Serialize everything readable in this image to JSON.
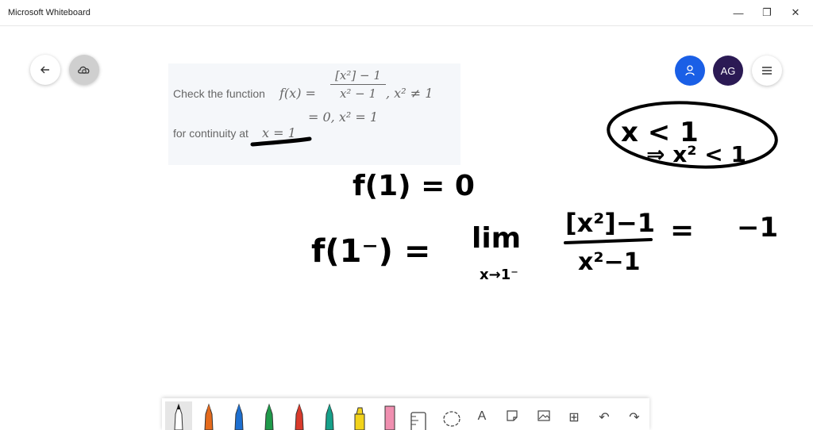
{
  "window": {
    "title": "Microsoft Whiteboard",
    "minimize_glyph": "—",
    "maximize_glyph": "❐",
    "close_glyph": "✕"
  },
  "header": {
    "back_icon": "arrow-left-icon",
    "sync_icon": "cloud-sync-icon",
    "invite_icon": "person-icon",
    "avatar_initials": "AG",
    "menu_icon": "hamburger-icon",
    "invite_color": "#1a5fe6",
    "avatar_color": "#2b1a54"
  },
  "question": {
    "line1_text": "Check the function",
    "fx": "f(x) =",
    "numerator": "[x²] − 1",
    "denominator": "x² − 1",
    "condition1": ",    x² ≠ 1",
    "line2_math": "= 0,    x² = 1",
    "line3_text": "for continuity at",
    "point": "x = 1"
  },
  "ink": {
    "line1": "f(1) = 0",
    "line2_left": "f(1⁻) =",
    "lim": "lim",
    "lim_sub": "x→1⁻",
    "numerator": "[x²]−1",
    "denominator": "x²−1",
    "equals": "=",
    "result": "−1",
    "note_top": "x < 1",
    "note_bottom": "⇒ x² < 1",
    "ink_color": "#000000"
  },
  "toolbar": {
    "tools": [
      {
        "name": "pen-black-icon",
        "color": "#111111"
      },
      {
        "name": "pen-orange-icon",
        "color": "#e46a1c"
      },
      {
        "name": "pen-blue-icon",
        "color": "#1d6fd0"
      },
      {
        "name": "pen-green-icon",
        "color": "#1f9a4a"
      },
      {
        "name": "pen-red-icon",
        "color": "#d93a2b"
      },
      {
        "name": "pen-teal-icon",
        "color": "#16a08a"
      },
      {
        "name": "highlighter-yellow-icon",
        "color": "#f2d31b"
      },
      {
        "name": "eraser-icon",
        "color": "#f08fb0"
      }
    ],
    "ruler_icon": "ruler-icon",
    "lasso_icon": "lasso-icon",
    "text_glyph": "A",
    "text_icon": "text-icon",
    "note_icon": "sticky-note-icon",
    "image_icon": "image-icon",
    "insert_glyph": "⊞",
    "insert_icon": "insert-icon",
    "undo_glyph": "↶",
    "undo_icon": "undo-icon",
    "redo_glyph": "↷",
    "redo_icon": "redo-icon"
  }
}
